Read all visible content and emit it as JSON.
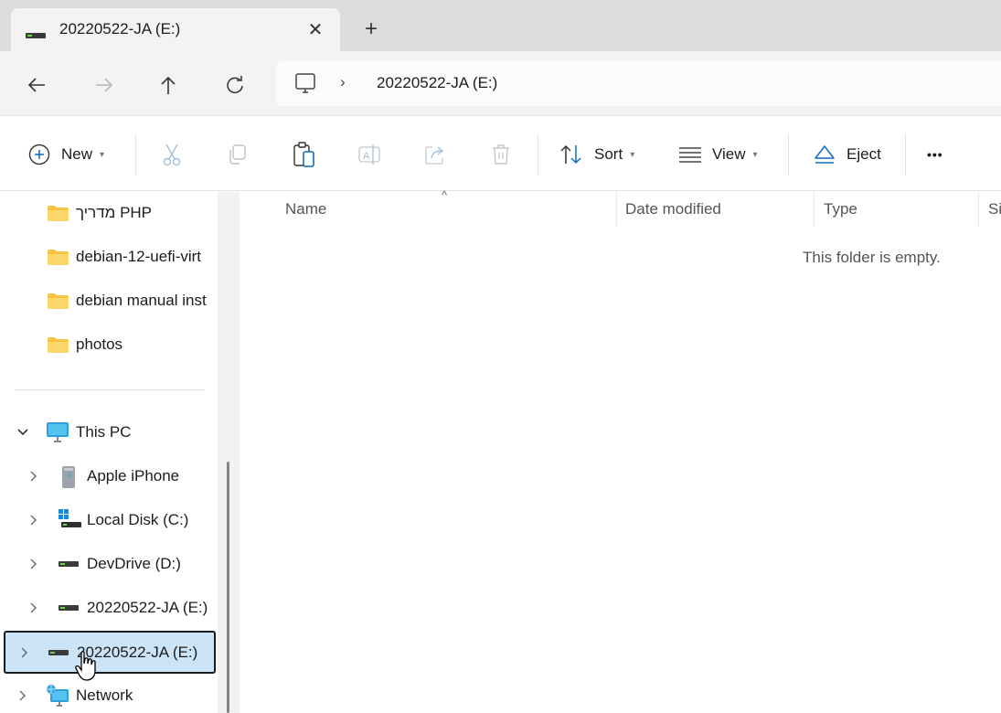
{
  "window": {
    "tab_title": "20220522-JA (E:)",
    "tab_icon": "drive-icon",
    "close_tab": "✕",
    "new_tab": "+"
  },
  "nav": {
    "back": "back-arrow-icon",
    "forward": "forward-arrow-icon",
    "up": "up-arrow-icon",
    "refresh": "refresh-icon",
    "address": {
      "root_icon": "this-pc-icon",
      "separator": "›",
      "crumbs": [
        "20220522-JA (E:)"
      ]
    }
  },
  "toolbar": {
    "new_label": "New",
    "sort_label": "Sort",
    "view_label": "View",
    "eject_label": "Eject",
    "more_label": "•••",
    "icons": [
      "new-icon",
      "cut-icon",
      "copy-icon",
      "paste-icon",
      "rename-icon",
      "share-icon",
      "delete-icon",
      "sort-icon",
      "view-icon",
      "eject-icon",
      "more-icon"
    ]
  },
  "sidebar": {
    "folders": [
      {
        "label": "מדריך PHP"
      },
      {
        "label": "debian-12-uefi-virt"
      },
      {
        "label": "debian manual inst"
      },
      {
        "label": "photos"
      }
    ],
    "this_pc": {
      "label": "This PC",
      "expanded": true,
      "children": [
        {
          "label": "Apple iPhone",
          "icon": "phone-icon"
        },
        {
          "label": "Local Disk (C:)",
          "icon": "windows-drive-icon"
        },
        {
          "label": "DevDrive (D:)",
          "icon": "drive-icon"
        },
        {
          "label": "20220522-JA (E:)",
          "icon": "drive-icon"
        }
      ]
    },
    "selected_drive": {
      "label": "20220522-JA (E:)",
      "icon": "drive-icon"
    },
    "network": {
      "label": "Network",
      "icon": "network-icon"
    }
  },
  "content": {
    "columns": [
      "Name",
      "Date modified",
      "Type",
      "Si"
    ],
    "sort_indicator": "^",
    "empty_message": "This folder is empty."
  }
}
